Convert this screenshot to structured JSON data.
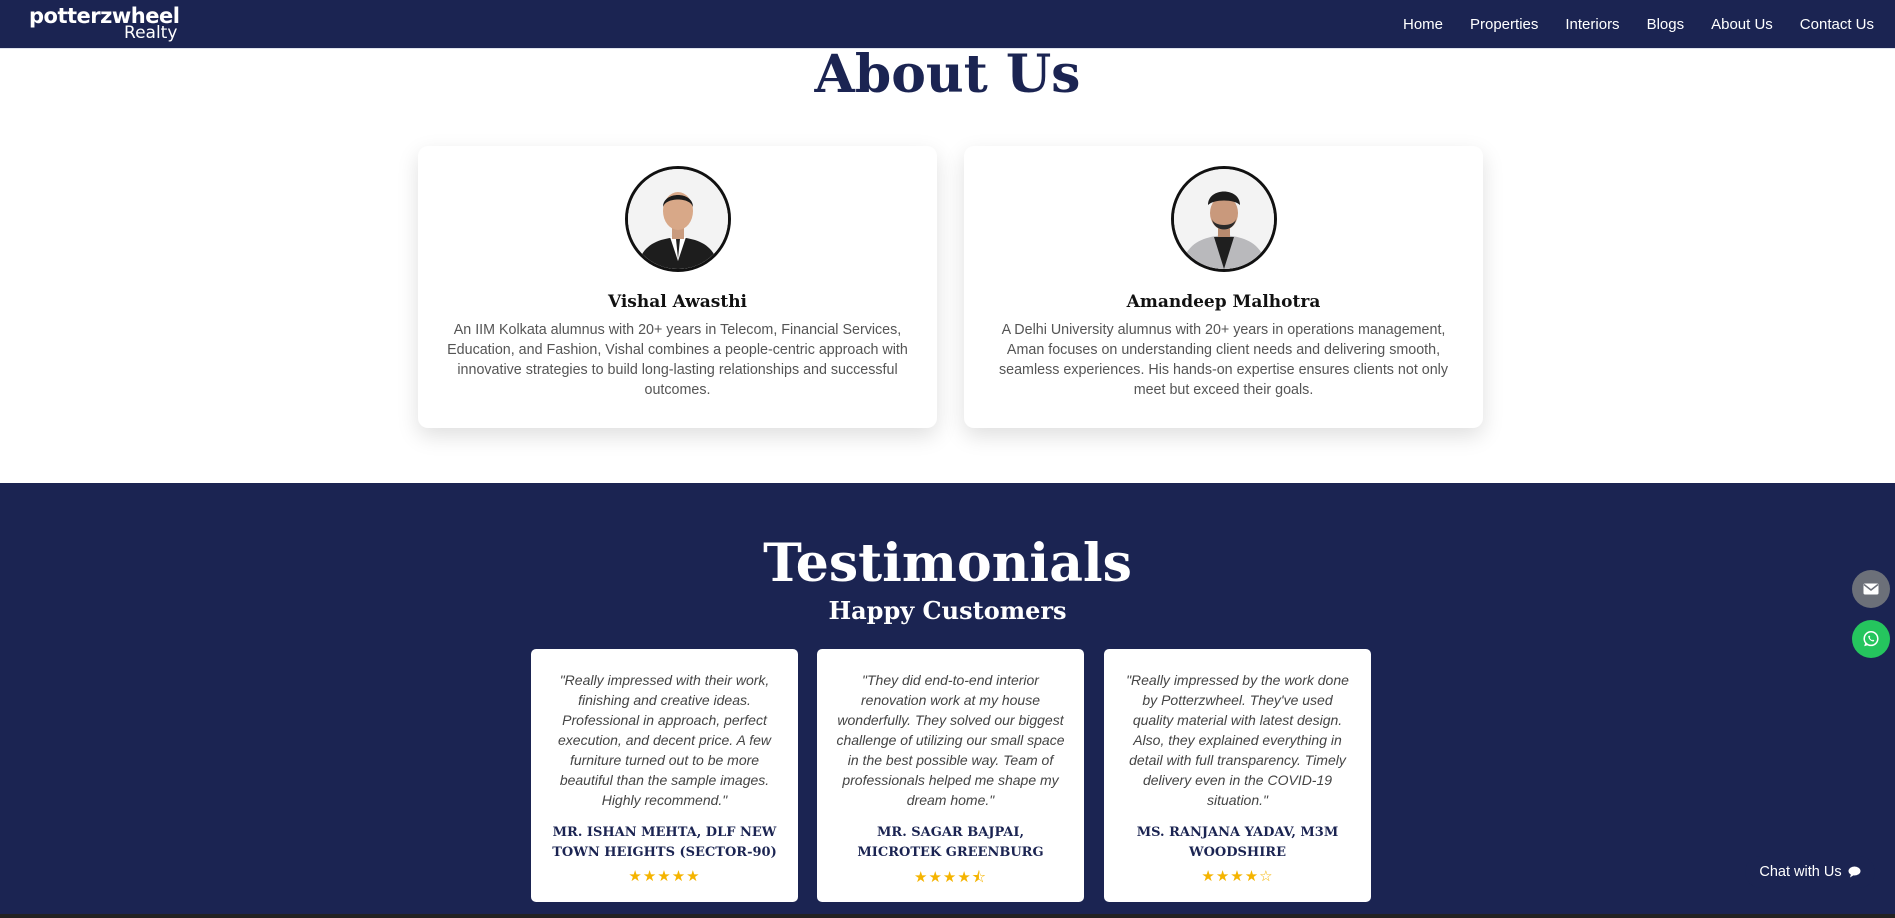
{
  "brand": {
    "logo_main": "potterzwheel",
    "logo_sub": "Realty"
  },
  "nav": {
    "items": [
      {
        "label": "Home"
      },
      {
        "label": "Properties"
      },
      {
        "label": "Interiors"
      },
      {
        "label": "Blogs"
      },
      {
        "label": "About Us"
      },
      {
        "label": "Contact Us"
      }
    ]
  },
  "about": {
    "title": "About Us",
    "members": [
      {
        "name": "Vishal Awasthi",
        "bio": "An IIM Kolkata alumnus with 20+ years in Telecom, Financial Services, Education, and Fashion, Vishal combines a people-centric approach with innovative strategies to build long-lasting relationships and successful outcomes."
      },
      {
        "name": "Amandeep Malhotra",
        "bio": "A Delhi University alumnus with 20+ years in operations management, Aman focuses on understanding client needs and delivering smooth, seamless experiences. His hands-on expertise ensures clients not only meet but exceed their goals."
      }
    ]
  },
  "testimonials": {
    "title": "Testimonials",
    "subtitle": "Happy Customers",
    "items": [
      {
        "quote": "\"Really impressed with their work, finishing and creative ideas. Professional in approach, perfect execution, and decent price. A few furniture turned out to be more beautiful than the sample images. Highly recommend.\"",
        "author": "MR. ISHAN MEHTA, DLF NEW TOWN HEIGHTS (SECTOR-90)",
        "rating": 5,
        "stars": "★★★★★"
      },
      {
        "quote": "\"They did end-to-end interior renovation work at my house wonderfully. They solved our biggest challenge of utilizing our small space in the best possible way. Team of professionals helped me shape my dream home.\"",
        "author": "MR. SAGAR BAJPAI, MICROTEK GREENBURG",
        "rating": 4.5,
        "stars": "★★★★⯪"
      },
      {
        "quote": "\"Really impressed by the work done by Potterzwheel. They've used quality material with latest design. Also, they explained everything in detail with full transparency. Timely delivery even in the COVID-19 situation.\"",
        "author": "MS. RANJANA YADAV, M3M WOODSHIRE",
        "rating": 4,
        "stars": "★★★★☆"
      }
    ]
  },
  "floating": {
    "mail_icon": "envelope-icon",
    "whatsapp_icon": "whatsapp-icon",
    "chat_label": "Chat with Us",
    "chat_icon": "chat-bubble-icon"
  },
  "colors": {
    "navy": "#1b2452",
    "star": "#f5b400",
    "whatsapp": "#25c55e",
    "mail": "#6c7079"
  }
}
